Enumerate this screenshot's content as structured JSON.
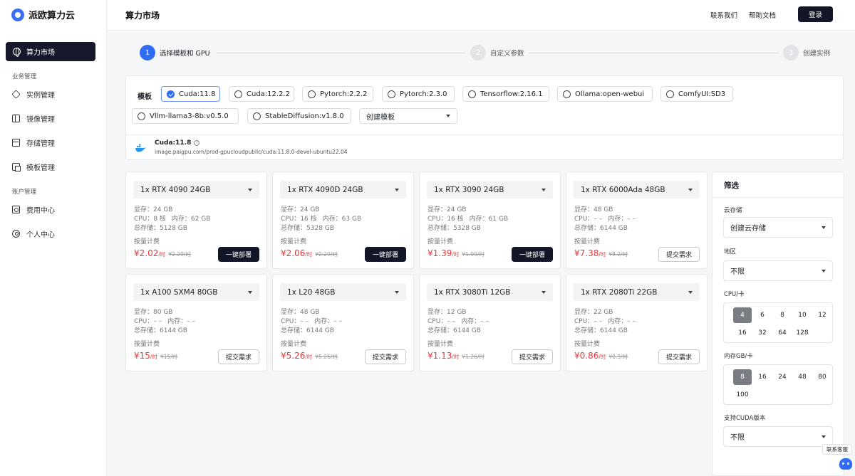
{
  "brand": {
    "name": "派欧算力云",
    "accent": "#3c6ef5"
  },
  "sidebar": {
    "active": {
      "label": "算力市场",
      "icon": "globe-icon"
    },
    "section_business": "业务管理",
    "business_items": [
      {
        "label": "实例管理",
        "icon": "layers-icon"
      },
      {
        "label": "镜像管理",
        "icon": "mirror-icon"
      },
      {
        "label": "存储管理",
        "icon": "storage-icon"
      },
      {
        "label": "模板管理",
        "icon": "template-icon"
      }
    ],
    "section_account": "账户管理",
    "account_items": [
      {
        "label": "费用中心",
        "icon": "billing-icon"
      },
      {
        "label": "个人中心",
        "icon": "user-icon"
      }
    ]
  },
  "header": {
    "title": "算力市场",
    "contact": "联系我们",
    "help": "帮助文档",
    "login": "登录"
  },
  "steps": [
    {
      "num": "1",
      "label": "选择模板和 GPU",
      "state": "active"
    },
    {
      "num": "2",
      "label": "自定义参数",
      "state": "inactive"
    },
    {
      "num": "3",
      "label": "创建实例",
      "state": "inactive"
    }
  ],
  "template": {
    "label": "模板",
    "options": [
      "Cuda:11.8",
      "Cuda:12.2.2",
      "Pytorch:2.2.2",
      "Pytorch:2.3.0",
      "Tensorflow:2.16.1",
      "Ollama:open-webui",
      "ComfyUI:SD3",
      "Vllm-llama3-8b:v0.5.0",
      "StableDiffusion:v1.8.0"
    ],
    "selected": "Cuda:11.8",
    "create_select": "创建模板",
    "info_name": "Cuda:11.8",
    "info_icon": "i",
    "info_url": "image.paigpu.com/prod-gpucloudpublic/cuda:11.8.0-devel-ubuntu22.04"
  },
  "gpu_labels": {
    "vram": "显存：",
    "cpu": "CPU：",
    "mem": "内存：",
    "disk": "总存储：",
    "billing": "按量计费",
    "per_hour": "/时",
    "deploy": "一键部署",
    "submit": "提交需求"
  },
  "gpus": [
    {
      "name": "1x RTX 4090 24GB",
      "vram": "24 GB",
      "cpu": "8 核",
      "mem": "62 GB",
      "disk": "5128 GB",
      "price": "¥2.02",
      "old": "¥2.29/时",
      "action": "deploy"
    },
    {
      "name": "1x RTX 4090D 24GB",
      "vram": "24 GB",
      "cpu": "16 核",
      "mem": "63 GB",
      "disk": "5328 GB",
      "price": "¥2.06",
      "old": "¥2.29/时",
      "action": "deploy"
    },
    {
      "name": "1x RTX 3090 24GB",
      "vram": "24 GB",
      "cpu": "16 核",
      "mem": "61 GB",
      "disk": "5328 GB",
      "price": "¥1.39",
      "old": "¥1.99/时",
      "action": "deploy"
    },
    {
      "name": "1x RTX 6000Ada 48GB",
      "vram": "48 GB",
      "cpu": "– –",
      "mem": "– –",
      "disk": "6144 GB",
      "price": "¥7.38",
      "old": "¥8.2/时",
      "action": "submit"
    },
    {
      "name": "1x A100 SXM4 80GB",
      "vram": "80 GB",
      "cpu": "– –",
      "mem": "– –",
      "disk": "6144 GB",
      "price": "¥15",
      "old": "¥15/时",
      "action": "submit"
    },
    {
      "name": "1x L20 48GB",
      "vram": "48 GB",
      "cpu": "– –",
      "mem": "– –",
      "disk": "6144 GB",
      "price": "¥5.26",
      "old": "¥5.26/时",
      "action": "submit"
    },
    {
      "name": "1x RTX 3080Ti 12GB",
      "vram": "12 GB",
      "cpu": "– –",
      "mem": "– –",
      "disk": "6144 GB",
      "price": "¥1.13",
      "old": "¥1.26/时",
      "action": "submit"
    },
    {
      "name": "1x RTX 2080Ti 22GB",
      "vram": "22 GB",
      "cpu": "– –",
      "mem": "– –",
      "disk": "6144 GB",
      "price": "¥0.86",
      "old": "¥0.9/时",
      "action": "submit"
    }
  ],
  "filter": {
    "title": "筛选",
    "cloud_label": "云存储",
    "cloud_value": "创建云存储",
    "region_label": "地区",
    "region_value": "不限",
    "cpu_label": "CPU/卡",
    "cpu_options": [
      "4",
      "6",
      "8",
      "10",
      "12",
      "16",
      "32",
      "64",
      "128"
    ],
    "cpu_selected": "4",
    "mem_label": "内存GB/卡",
    "mem_options": [
      "8",
      "16",
      "24",
      "48",
      "80",
      "100"
    ],
    "mem_selected": "8",
    "cuda_label": "支持CUDA版本",
    "cuda_value": "不限"
  },
  "customer_service": "联系客服",
  "colors": {
    "primary_dark": "#121626",
    "price_red": "#e03a3a",
    "step_blue": "#2f6cf6"
  }
}
